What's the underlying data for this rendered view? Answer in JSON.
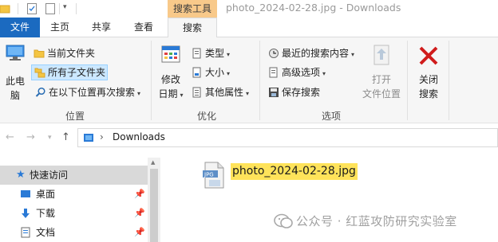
{
  "titlebar": {
    "context_tab_header": "搜索工具",
    "window_title": "photo_2024-02-28.jpg - Downloads"
  },
  "tabs": {
    "file": "文件",
    "home": "主页",
    "share": "共享",
    "view": "查看",
    "search": "搜索"
  },
  "ribbon": {
    "location": {
      "label": "位置",
      "this_pc": [
        "此电",
        "脑"
      ],
      "current_folder": "当前文件夹",
      "all_subfolders": "所有子文件夹",
      "search_again": "在以下位置再次搜索"
    },
    "refine": {
      "label": "优化",
      "date_modified": [
        "修改",
        "日期"
      ],
      "type": "类型",
      "size": "大小",
      "other_properties": "其他属性"
    },
    "options": {
      "label": "选项",
      "recent_searches": "最近的搜索内容",
      "advanced_options": "高级选项",
      "save_search": "保存搜索",
      "open_file_location": [
        "打开",
        "文件位置"
      ]
    },
    "close": {
      "close_search": [
        "关闭",
        "搜索"
      ]
    }
  },
  "address": {
    "path": "Downloads"
  },
  "navpane": {
    "items": [
      {
        "label": "快速访问"
      },
      {
        "label": "桌面"
      },
      {
        "label": "下载"
      },
      {
        "label": "文档"
      }
    ]
  },
  "content": {
    "file_name": "photo_2024-02-28.jpg",
    "file_icon_text": "JPG"
  },
  "watermark": {
    "text": "公众号 · 红蓝攻防研究实验室"
  },
  "colors": {
    "accent": "#1b6ac0",
    "context_tab": "#f8c98a",
    "highlight": "#ffe35a",
    "selected_nav": "#cce8ff"
  }
}
